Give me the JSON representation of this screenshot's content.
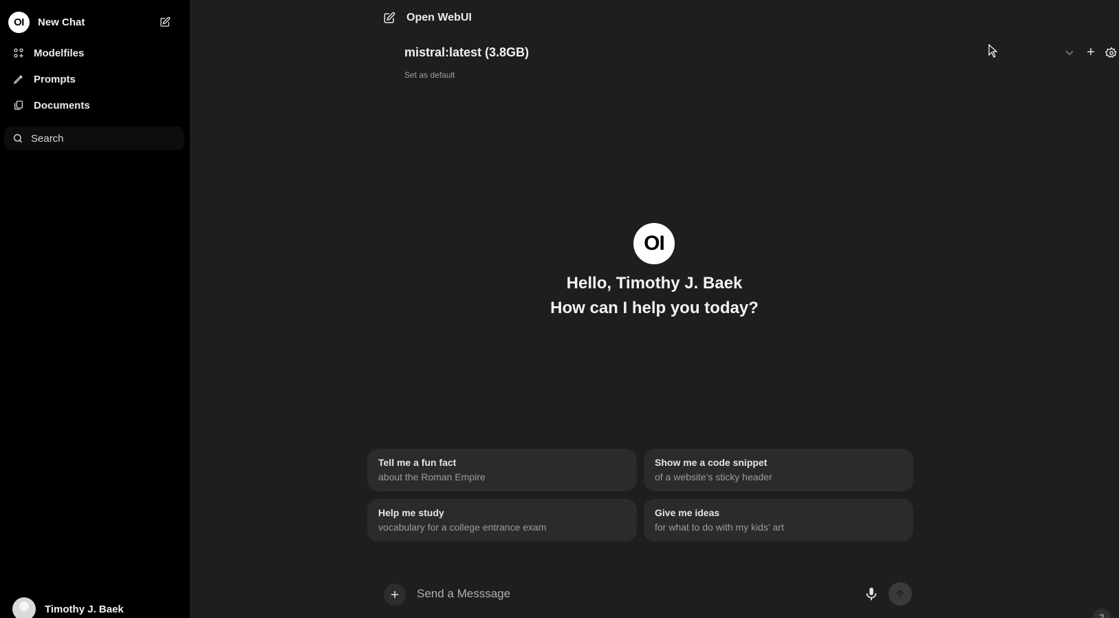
{
  "sidebar": {
    "logo_text": "OI",
    "new_chat_label": "New Chat",
    "items": [
      {
        "label": "Modelfiles",
        "icon": "modelfiles-icon"
      },
      {
        "label": "Prompts",
        "icon": "pencil-icon"
      },
      {
        "label": "Documents",
        "icon": "documents-icon"
      }
    ],
    "search_label": "Search",
    "user_name": "Timothy J. Baek"
  },
  "header": {
    "app_title": "Open WebUI"
  },
  "model": {
    "name": "mistral:latest (3.8GB)",
    "set_default_label": "Set as default",
    "add_label": "+"
  },
  "hero": {
    "logo_text": "OI",
    "greeting": "Hello, Timothy J. Baek",
    "subtitle": "How can I help you today?"
  },
  "suggestions": [
    {
      "title": "Tell me a fun fact",
      "subtitle": "about the Roman Empire"
    },
    {
      "title": "Show me a code snippet",
      "subtitle": "of a website's sticky header"
    },
    {
      "title": "Help me study",
      "subtitle": "vocabulary for a college entrance exam"
    },
    {
      "title": "Give me ideas",
      "subtitle": "for what to do with my kids' art"
    }
  ],
  "composer": {
    "placeholder": "Send a Messsage"
  },
  "help_label": "?",
  "colors": {
    "sidebar_bg": "#000000",
    "main_bg": "#1e1e1e",
    "card_bg": "#2b2b2b",
    "text": "#ececec"
  }
}
